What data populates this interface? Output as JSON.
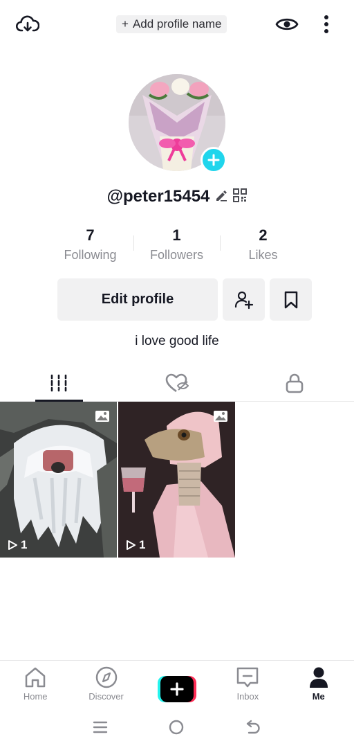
{
  "top_bar": {
    "add_profile_name": "Add profile name",
    "add_icon": "plus-icon",
    "left_icon": "cloud-download-icon",
    "eye_icon": "eye-icon",
    "more_icon": "more-vertical-icon"
  },
  "profile": {
    "handle": "@peter15454",
    "bio": "i love good life",
    "avatar_icon": "avatar-flower-bouquet",
    "add_badge_color": "#20d5ec"
  },
  "stats": [
    {
      "value": "7",
      "label": "Following"
    },
    {
      "value": "1",
      "label": "Followers"
    },
    {
      "value": "2",
      "label": "Likes"
    }
  ],
  "actions": {
    "edit_profile": "Edit profile",
    "add_friend_icon": "add-user-icon",
    "bookmark_icon": "bookmark-icon"
  },
  "tabs": [
    {
      "icon": "grid-videos-icon",
      "active": true
    },
    {
      "icon": "liked-hidden-icon",
      "active": false
    },
    {
      "icon": "lock-icon",
      "active": false
    }
  ],
  "videos": [
    {
      "views": "1",
      "badge_icon": "photo-icon"
    },
    {
      "views": "1",
      "badge_icon": "photo-icon"
    }
  ],
  "bottom_nav": [
    {
      "label": "Home",
      "icon": "home-icon",
      "active": false
    },
    {
      "label": "Discover",
      "icon": "compass-icon",
      "active": false
    },
    {
      "label": "",
      "icon": "create-plus-icon",
      "active": false
    },
    {
      "label": "Inbox",
      "icon": "inbox-icon",
      "active": false
    },
    {
      "label": "Me",
      "icon": "person-icon",
      "active": true
    }
  ],
  "colors": {
    "accent_cyan": "#25f4ee",
    "accent_pink": "#fe2c55",
    "text_primary": "#161823",
    "text_secondary": "#8a8b91"
  }
}
